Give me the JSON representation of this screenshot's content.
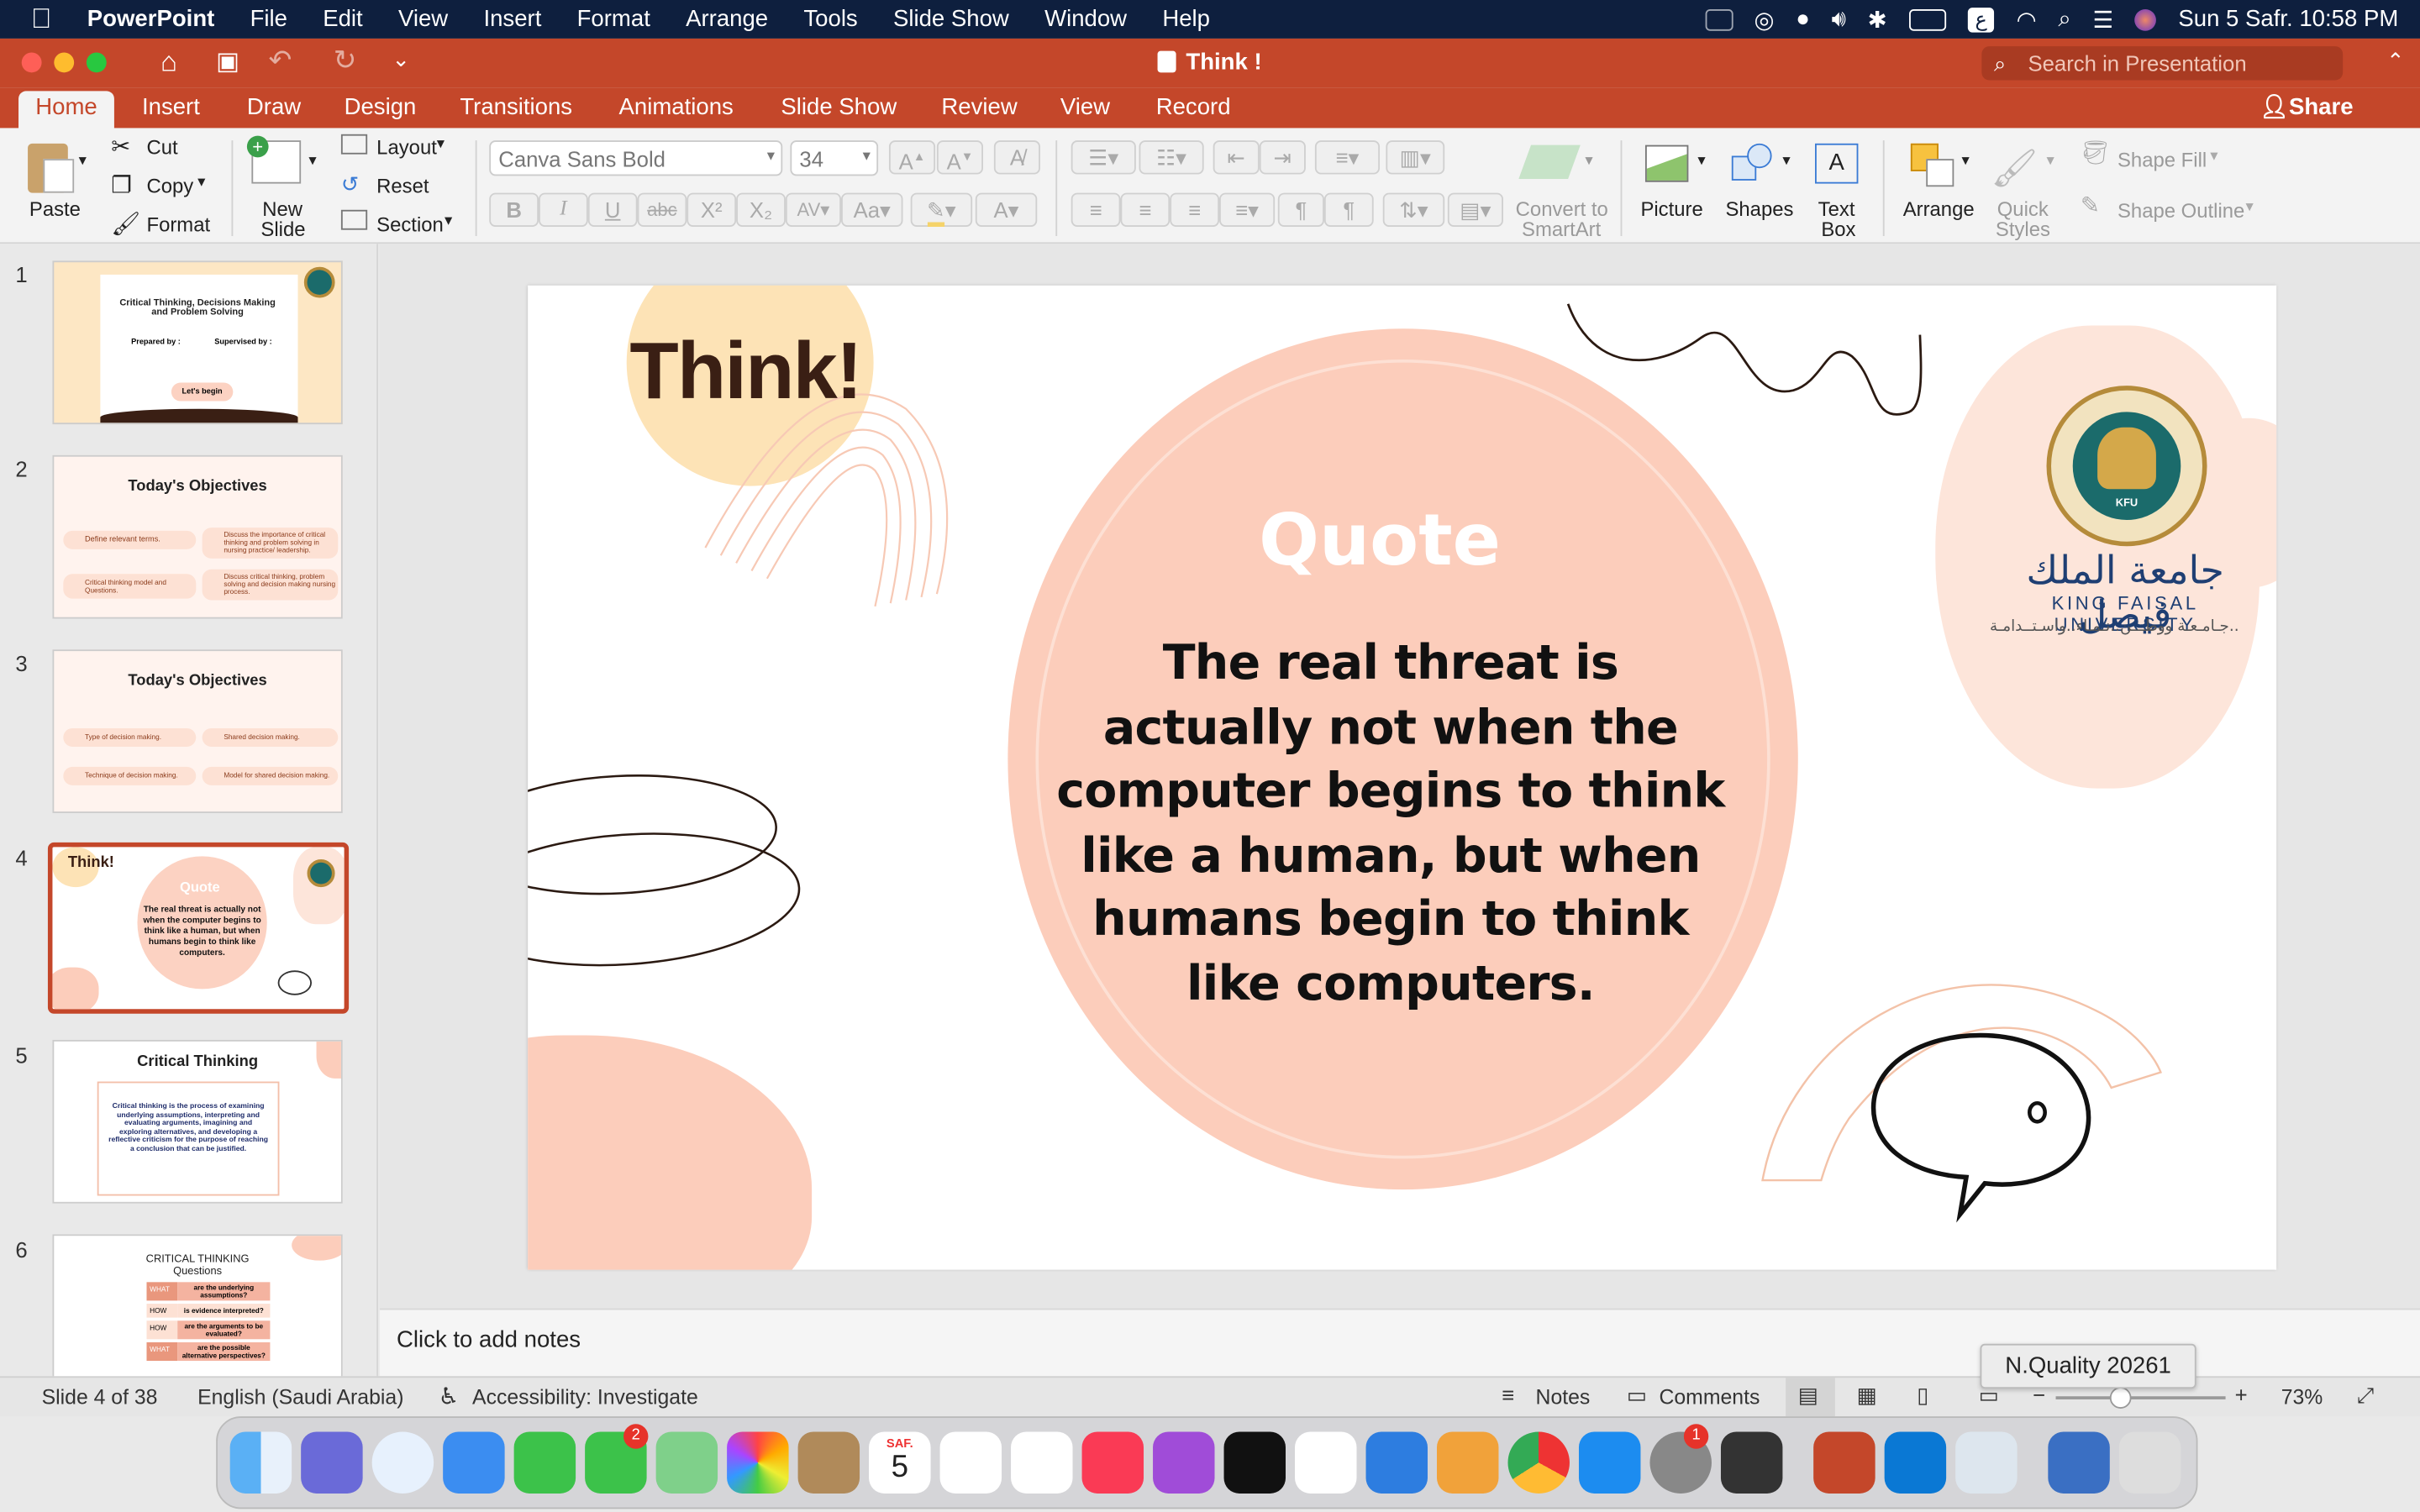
{
  "menubar": {
    "apple": "",
    "app_name": "PowerPoint",
    "items": [
      "File",
      "Edit",
      "View",
      "Insert",
      "Format",
      "Arrange",
      "Tools",
      "Slide Show",
      "Window",
      "Help"
    ],
    "keyboard_lang": "ع",
    "datetime": "Sun 5 Safr.  10:58 PM"
  },
  "window": {
    "title": "Think !",
    "search_placeholder": "Search in Presentation"
  },
  "tabs": [
    "Home",
    "Insert",
    "Draw",
    "Design",
    "Transitions",
    "Animations",
    "Slide Show",
    "Review",
    "View",
    "Record"
  ],
  "active_tab": "Home",
  "share_label": "Share",
  "ribbon": {
    "paste": "Paste",
    "cut": "Cut",
    "copy": "Copy",
    "format": "Format",
    "new_slide_1": "New",
    "new_slide_2": "Slide",
    "layout": "Layout",
    "reset": "Reset",
    "section": "Section",
    "font_name": "Canva Sans Bold",
    "font_size": "34",
    "convert_1": "Convert to",
    "convert_2": "SmartArt",
    "picture": "Picture",
    "shapes": "Shapes",
    "textbox_1": "Text",
    "textbox_2": "Box",
    "arrange": "Arrange",
    "quick_1": "Quick",
    "quick_2": "Styles",
    "shape_fill": "Shape Fill",
    "shape_outline": "Shape Outline"
  },
  "thumbnails": [
    {
      "num": "1",
      "title": "Critical Thinking, Decisions Making and Problem Solving",
      "sub1": "Prepared by :",
      "sub2": "Supervised by :",
      "button": "Let's begin"
    },
    {
      "num": "2",
      "title": "Today's Objectives",
      "items": [
        "Define relevant terms.",
        "Discuss the importance of critical thinking and problem solving in nursing practice/ leadership.",
        "Critical thinking model and Questions.",
        "Discuss critical thinking, problem solving and decision making nursing process."
      ]
    },
    {
      "num": "3",
      "title": "Today's Objectives",
      "items": [
        "Type of decision making.",
        "Shared decision making.",
        "Technique of decision making.",
        "Model for shared decision making."
      ]
    },
    {
      "num": "4",
      "title": "Think!",
      "quote_title": "Quote",
      "quote": "The real threat is actually not when the computer begins to think like a human, but when humans begin to think like computers."
    },
    {
      "num": "5",
      "title": "Critical Thinking",
      "body": "Critical thinking is the process of examining underlying assumptions, interpreting and evaluating arguments, imagining and exploring alternatives, and developing a reflective criticism for the purpose of reaching a conclusion that can be justified."
    },
    {
      "num": "6",
      "title": "CRITICAL THINKING",
      "subtitle": "Questions",
      "rows": [
        [
          "WHAT",
          "are the underlying assumptions?"
        ],
        [
          "HOW",
          "is evidence interpreted?"
        ],
        [
          "HOW",
          "are the arguments to be evaluated?"
        ],
        [
          "WHAT",
          "are the possible alternative perspectives?"
        ]
      ]
    }
  ],
  "slide": {
    "think": "Think!",
    "quote_title": "Quote",
    "quote_text": "The real threat is actually not when the computer begins to think like a human, but when humans begin to think like computers.",
    "logo_arabic": "جامعة الملك فيصل",
    "logo_english": "KING FAISAL UNIVERSITY",
    "logo_tagline": "جـامـعـة ووطـــن..نـمـاء..واسـتــدامـة..",
    "logo_badge": "KFU"
  },
  "notes_placeholder": "Click to add notes",
  "statusbar": {
    "slide_info": "Slide 4 of 38",
    "language": "English (Saudi Arabia)",
    "accessibility": "Accessibility: Investigate",
    "notes": "Notes",
    "comments": "Comments",
    "zoom": "73%"
  },
  "tooltip": "N.Quality 20261",
  "dock": {
    "calendar_month": "SAF.",
    "calendar_day": "5",
    "messages_badge": "2",
    "settings_badge": "1"
  },
  "colors": {
    "ribbon_accent": "#c4472a",
    "menubar": "#0e1f3e",
    "peach": "#fccdbb"
  }
}
